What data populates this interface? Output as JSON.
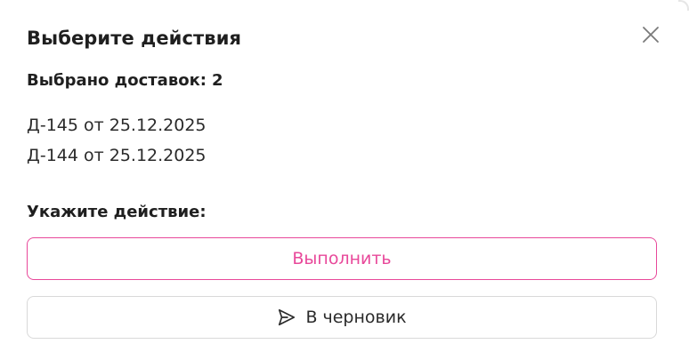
{
  "dialog": {
    "title": "Выберите действия",
    "close_icon": "close-icon",
    "selected": {
      "label": "Выбрано доставок:",
      "count": "2"
    },
    "deliveries": [
      "Д-145 от 25.12.2025",
      "Д-144 от 25.12.2025"
    ],
    "action_label": "Укажите действие:",
    "execute_button": {
      "label": "Выполнить",
      "color": "#e8489a"
    },
    "draft_button": {
      "label": "В черновик",
      "icon": "send-icon"
    }
  }
}
